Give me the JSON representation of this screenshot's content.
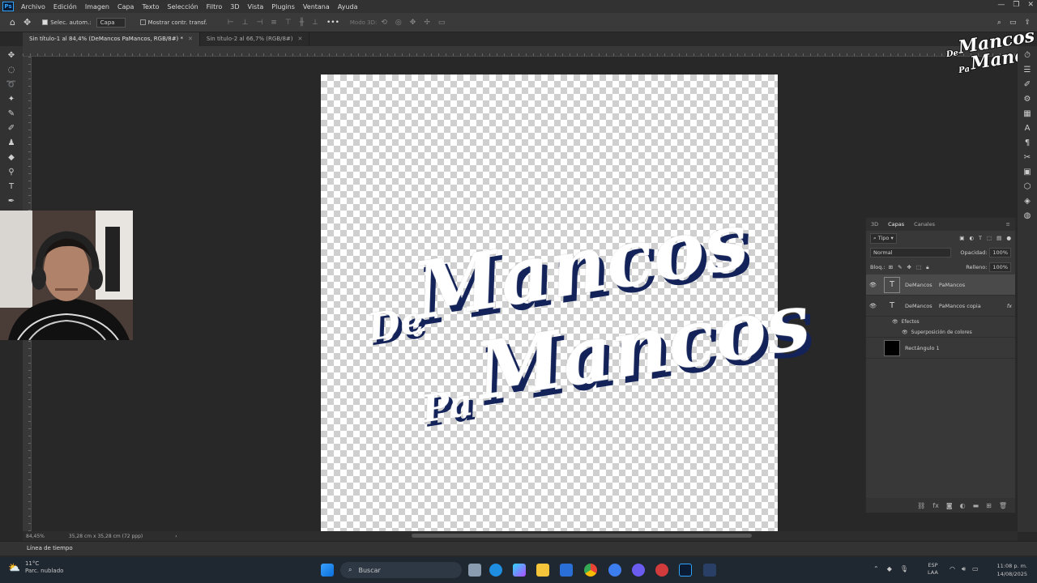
{
  "menu": {
    "app_logo": "Ps",
    "items": [
      "Archivo",
      "Edición",
      "Imagen",
      "Capa",
      "Texto",
      "Selección",
      "Filtro",
      "3D",
      "Vista",
      "Plugins",
      "Ventana",
      "Ayuda"
    ]
  },
  "options": {
    "auto_select_label": "Selec. autom.:",
    "auto_select_value": "Capa",
    "show_transform_label": "Mostrar contr. transf.",
    "mode_3d": "Modo 3D:"
  },
  "tabs": [
    {
      "label": "Sin título-1 al 84,4% (DeMancos   PaMancos, RGB/8#) *",
      "active": true
    },
    {
      "label": "Sin título-2 al 66,7% (RGB/8#)",
      "active": false
    }
  ],
  "canvas_text": {
    "line1_small": "De",
    "line1_big": "Mancos",
    "line2_small": "Pa",
    "line2_big": "Mancos"
  },
  "watermark": {
    "line1_small": "De",
    "line1_big": "Mancos",
    "line2_small": "Pa",
    "line2_big": "Mancos"
  },
  "layers_panel": {
    "tabs": [
      "3D",
      "Capas",
      "Canales"
    ],
    "active_tab": "Capas",
    "filter": "Tipo",
    "blend_mode": "Normal",
    "opacity_label": "Opacidad:",
    "opacity_value": "100%",
    "lock_label": "Bloq.:",
    "fill_label": "Relleno:",
    "fill_value": "100%",
    "layers": [
      {
        "name": "DeMancos    PaMancos",
        "type": "T",
        "visible": true,
        "selected": true
      },
      {
        "name": "DeMancos    PaMancos copia",
        "type": "T",
        "visible": true,
        "fx": "fx"
      },
      {
        "name": "Rectángulo 1",
        "type": "rect",
        "visible": false
      }
    ],
    "effects_label": "Efectos",
    "effect_item": "Superposición de colores"
  },
  "status": {
    "zoom": "84,45%",
    "doc_size": "35,28 cm x 35,28 cm (72 ppp)"
  },
  "timeline_label": "Línea de tiempo",
  "taskbar": {
    "temperature": "11°C",
    "weather": "Parc. nublado",
    "search_placeholder": "Buscar",
    "lang1": "ESP",
    "lang2": "LAA",
    "time": "11:08 p. m.",
    "date": "14/08/2025"
  },
  "colors": {
    "navy": "#13235a",
    "ps_blue": "#2fa3ff"
  }
}
